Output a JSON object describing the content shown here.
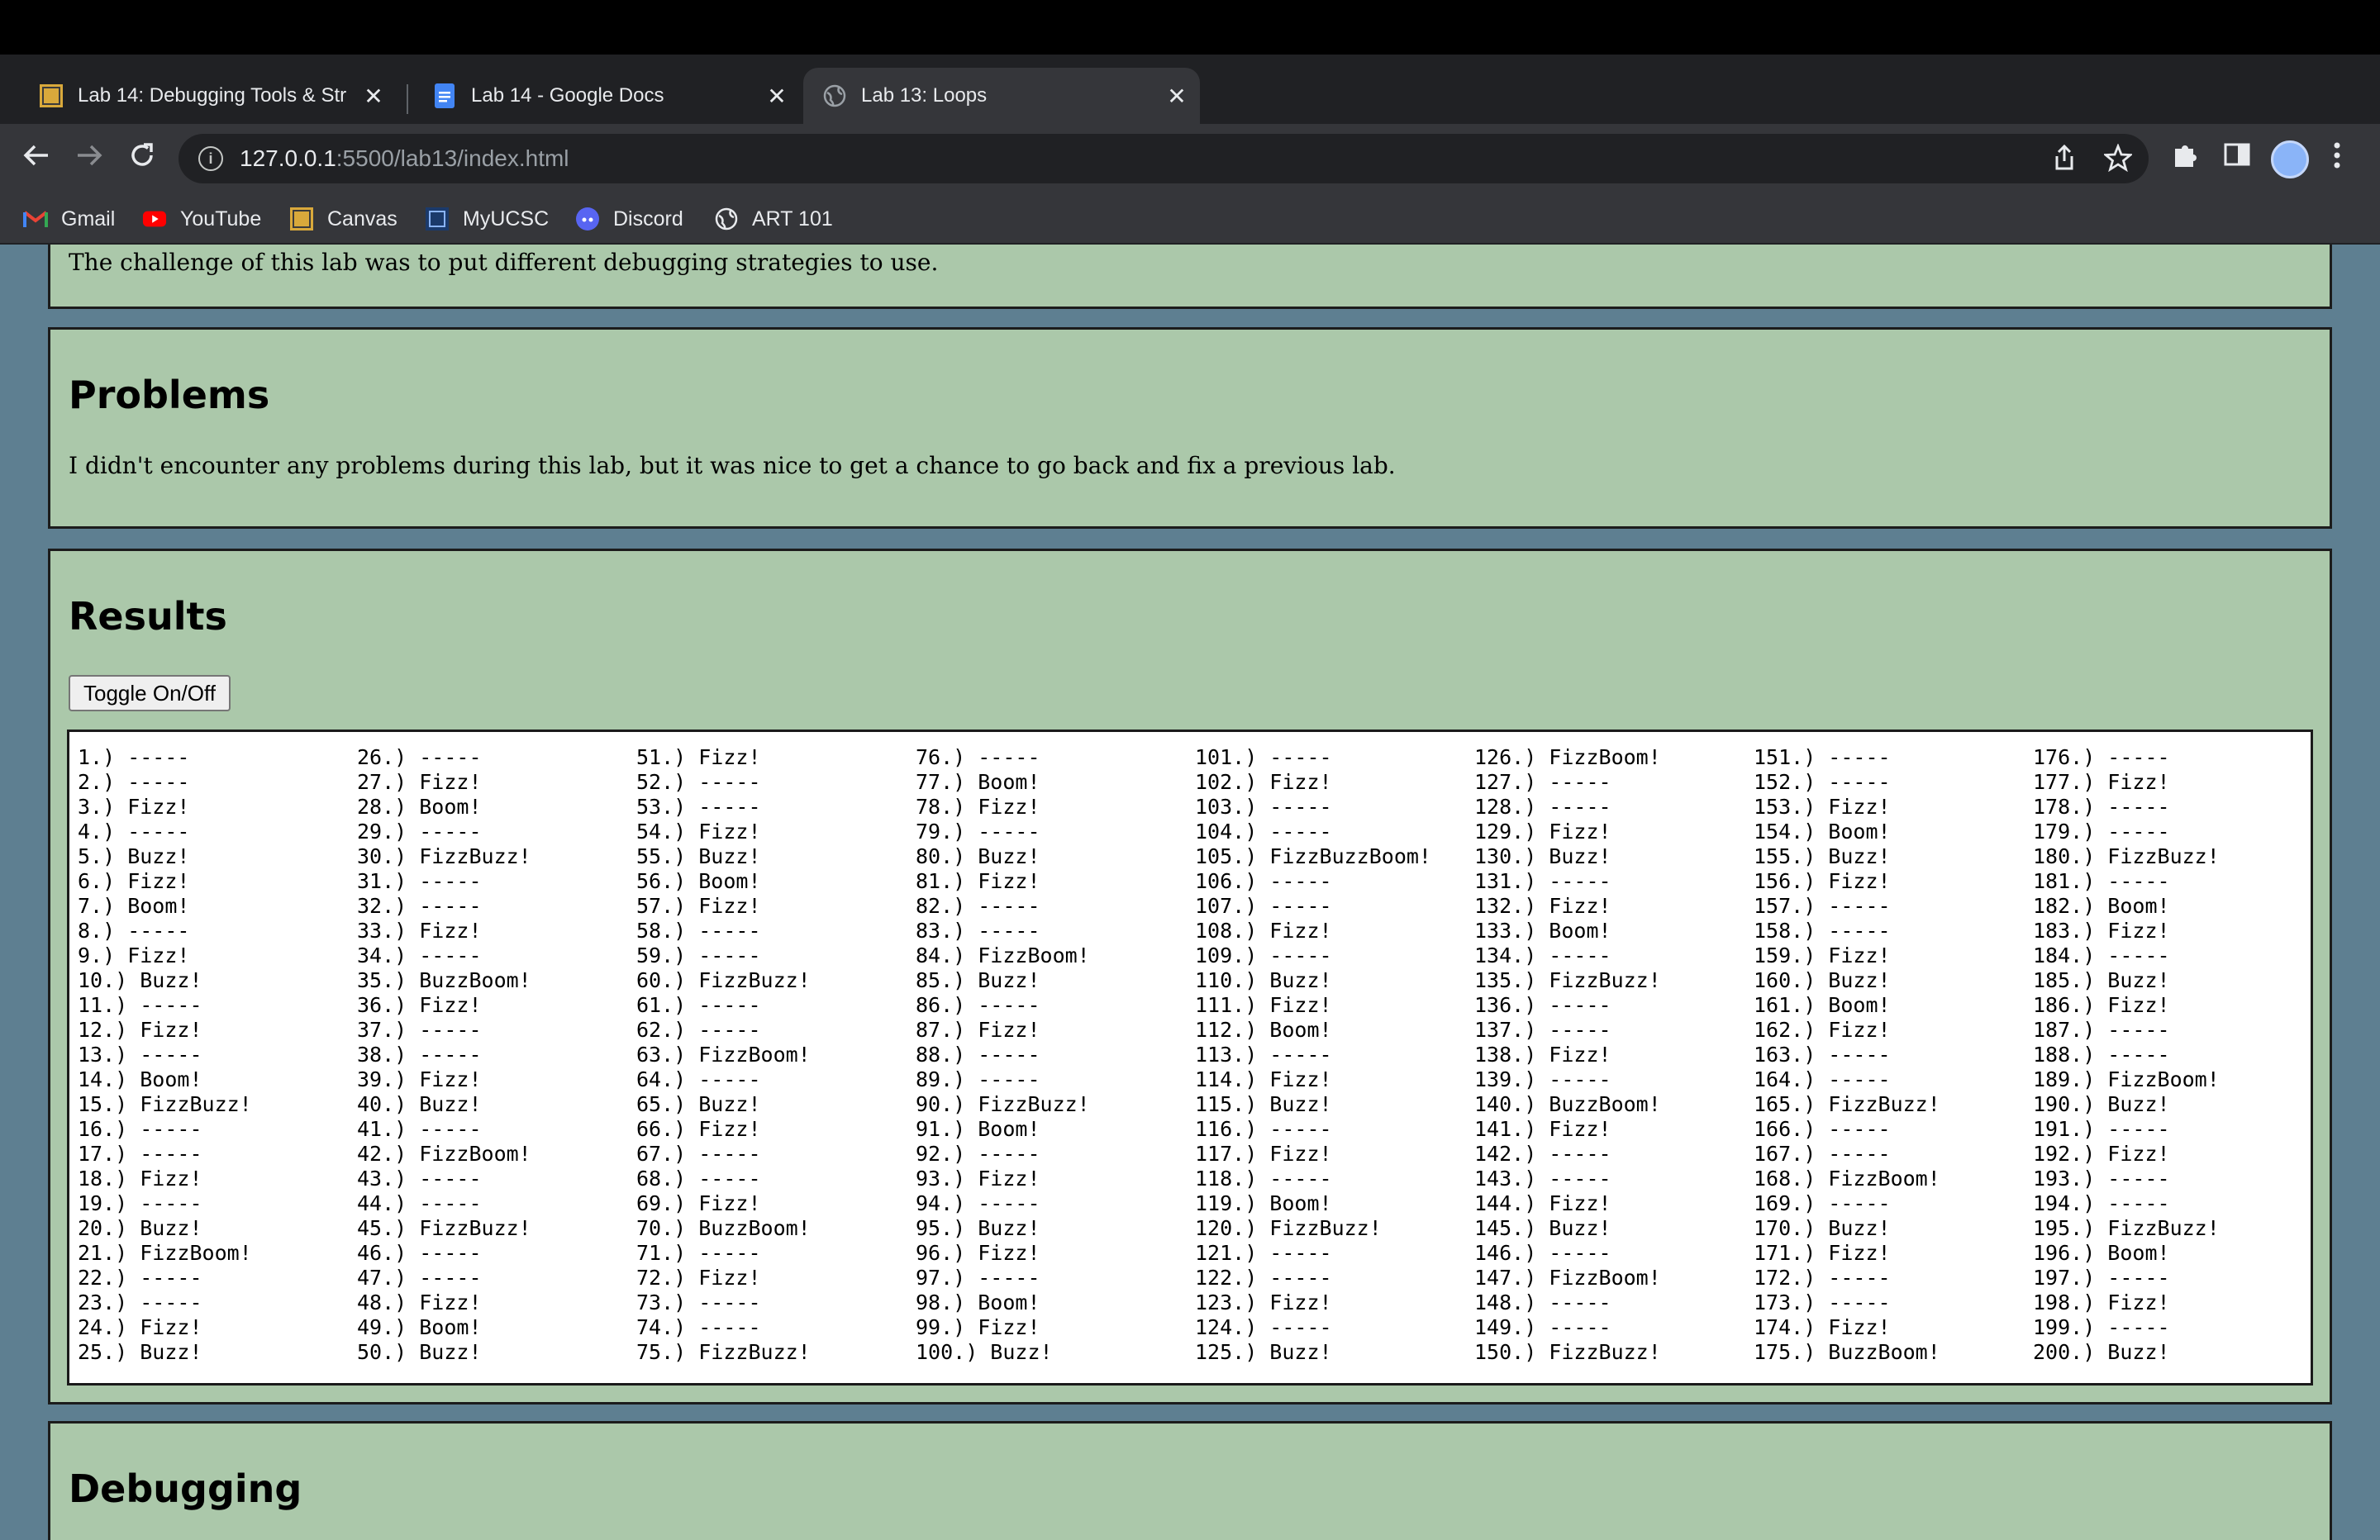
{
  "browser": {
    "tabs": [
      {
        "title": "Lab 14: Debugging Tools & Str",
        "icon": "ucsc-favicon",
        "active": false
      },
      {
        "title": "Lab 14 - Google Docs",
        "icon": "docs-favicon",
        "active": false
      },
      {
        "title": "Lab 13: Loops",
        "icon": "globe-favicon",
        "active": true
      }
    ],
    "close_glyph": "✕",
    "new_tab_glyph": "+",
    "url_host": "127.0.0.1",
    "url_rest": ":5500/lab13/index.html",
    "bookmarks": [
      {
        "label": "Gmail",
        "icon": "gmail-icon"
      },
      {
        "label": "YouTube",
        "icon": "youtube-icon"
      },
      {
        "label": "Canvas",
        "icon": "canvas-icon"
      },
      {
        "label": "MyUCSC",
        "icon": "myucsc-icon"
      },
      {
        "label": "Discord",
        "icon": "discord-icon"
      },
      {
        "label": "ART 101",
        "icon": "globe-icon"
      }
    ]
  },
  "page": {
    "challenge_text": "The challenge of this lab was to put different debugging strategies to use.",
    "problems": {
      "heading": "Problems",
      "text": "I didn't encounter any problems during this lab, but it was nice to get a chance to go back and fix a previous lab."
    },
    "results": {
      "heading": "Results",
      "toggle_label": "Toggle On/Off",
      "lines": [
        "1.) -----",
        "2.) -----",
        "3.) Fizz!",
        "4.) -----",
        "5.) Buzz!",
        "6.) Fizz!",
        "7.) Boom!",
        "8.) -----",
        "9.) Fizz!",
        "10.) Buzz!",
        "11.) -----",
        "12.) Fizz!",
        "13.) -----",
        "14.) Boom!",
        "15.) FizzBuzz!",
        "16.) -----",
        "17.) -----",
        "18.) Fizz!",
        "19.) -----",
        "20.) Buzz!",
        "21.) FizzBoom!",
        "22.) -----",
        "23.) -----",
        "24.) Fizz!",
        "25.) Buzz!",
        "26.) -----",
        "27.) Fizz!",
        "28.) Boom!",
        "29.) -----",
        "30.) FizzBuzz!",
        "31.) -----",
        "32.) -----",
        "33.) Fizz!",
        "34.) -----",
        "35.) BuzzBoom!",
        "36.) Fizz!",
        "37.) -----",
        "38.) -----",
        "39.) Fizz!",
        "40.) Buzz!",
        "41.) -----",
        "42.) FizzBoom!",
        "43.) -----",
        "44.) -----",
        "45.) FizzBuzz!",
        "46.) -----",
        "47.) -----",
        "48.) Fizz!",
        "49.) Boom!",
        "50.) Buzz!",
        "51.) Fizz!",
        "52.) -----",
        "53.) -----",
        "54.) Fizz!",
        "55.) Buzz!",
        "56.) Boom!",
        "57.) Fizz!",
        "58.) -----",
        "59.) -----",
        "60.) FizzBuzz!",
        "61.) -----",
        "62.) -----",
        "63.) FizzBoom!",
        "64.) -----",
        "65.) Buzz!",
        "66.) Fizz!",
        "67.) -----",
        "68.) -----",
        "69.) Fizz!",
        "70.) BuzzBoom!",
        "71.) -----",
        "72.) Fizz!",
        "73.) -----",
        "74.) -----",
        "75.) FizzBuzz!",
        "76.) -----",
        "77.) Boom!",
        "78.) Fizz!",
        "79.) -----",
        "80.) Buzz!",
        "81.) Fizz!",
        "82.) -----",
        "83.) -----",
        "84.) FizzBoom!",
        "85.) Buzz!",
        "86.) -----",
        "87.) Fizz!",
        "88.) -----",
        "89.) -----",
        "90.) FizzBuzz!",
        "91.) Boom!",
        "92.) -----",
        "93.) Fizz!",
        "94.) -----",
        "95.) Buzz!",
        "96.) Fizz!",
        "97.) -----",
        "98.) Boom!",
        "99.) Fizz!",
        "100.) Buzz!",
        "101.) -----",
        "102.) Fizz!",
        "103.) -----",
        "104.) -----",
        "105.) FizzBuzzBoom!",
        "106.) -----",
        "107.) -----",
        "108.) Fizz!",
        "109.) -----",
        "110.) Buzz!",
        "111.) Fizz!",
        "112.) Boom!",
        "113.) -----",
        "114.) Fizz!",
        "115.) Buzz!",
        "116.) -----",
        "117.) Fizz!",
        "118.) -----",
        "119.) Boom!",
        "120.) FizzBuzz!",
        "121.) -----",
        "122.) -----",
        "123.) Fizz!",
        "124.) -----",
        "125.) Buzz!",
        "126.) FizzBoom!",
        "127.) -----",
        "128.) -----",
        "129.) Fizz!",
        "130.) Buzz!",
        "131.) -----",
        "132.) Fizz!",
        "133.) Boom!",
        "134.) -----",
        "135.) FizzBuzz!",
        "136.) -----",
        "137.) -----",
        "138.) Fizz!",
        "139.) -----",
        "140.) BuzzBoom!",
        "141.) Fizz!",
        "142.) -----",
        "143.) -----",
        "144.) Fizz!",
        "145.) Buzz!",
        "146.) -----",
        "147.) FizzBoom!",
        "148.) -----",
        "149.) -----",
        "150.) FizzBuzz!",
        "151.) -----",
        "152.) -----",
        "153.) Fizz!",
        "154.) Boom!",
        "155.) Buzz!",
        "156.) Fizz!",
        "157.) -----",
        "158.) -----",
        "159.) Fizz!",
        "160.) Buzz!",
        "161.) Boom!",
        "162.) Fizz!",
        "163.) -----",
        "164.) -----",
        "165.) FizzBuzz!",
        "166.) -----",
        "167.) -----",
        "168.) FizzBoom!",
        "169.) -----",
        "170.) Buzz!",
        "171.) Fizz!",
        "172.) -----",
        "173.) -----",
        "174.) Fizz!",
        "175.) BuzzBoom!",
        "176.) -----",
        "177.) Fizz!",
        "178.) -----",
        "179.) -----",
        "180.) FizzBuzz!",
        "181.) -----",
        "182.) Boom!",
        "183.) Fizz!",
        "184.) -----",
        "185.) Buzz!",
        "186.) Fizz!",
        "187.) -----",
        "188.) -----",
        "189.) FizzBoom!",
        "190.) Buzz!",
        "191.) -----",
        "192.) Fizz!",
        "193.) -----",
        "194.) -----",
        "195.) FizzBuzz!",
        "196.) Boom!",
        "197.) -----",
        "198.) Fizz!",
        "199.) -----",
        "200.) Buzz!"
      ]
    },
    "debugging": {
      "heading": "Debugging"
    }
  }
}
